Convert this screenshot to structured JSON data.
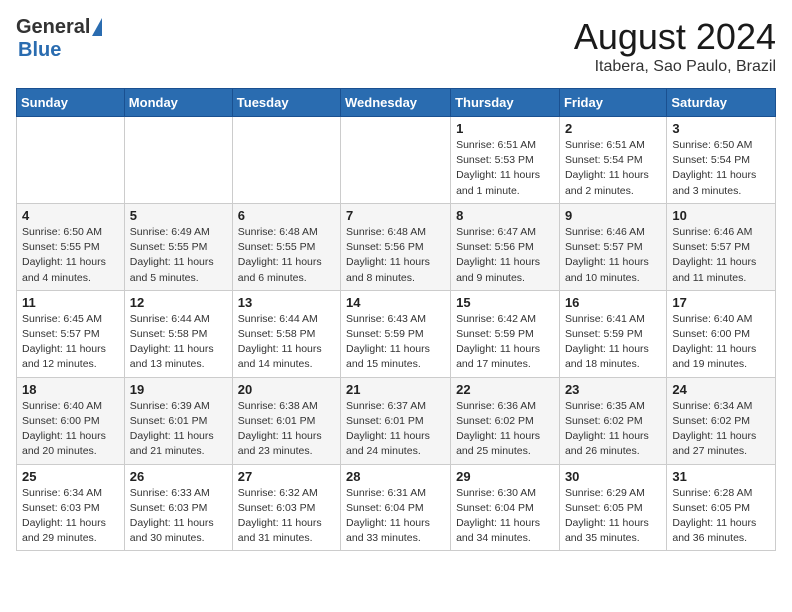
{
  "header": {
    "logo_general": "General",
    "logo_blue": "Blue",
    "title": "August 2024",
    "subtitle": "Itabera, Sao Paulo, Brazil"
  },
  "calendar": {
    "days_of_week": [
      "Sunday",
      "Monday",
      "Tuesday",
      "Wednesday",
      "Thursday",
      "Friday",
      "Saturday"
    ],
    "weeks": [
      [
        {
          "day": "",
          "info": ""
        },
        {
          "day": "",
          "info": ""
        },
        {
          "day": "",
          "info": ""
        },
        {
          "day": "",
          "info": ""
        },
        {
          "day": "1",
          "info": "Sunrise: 6:51 AM\nSunset: 5:53 PM\nDaylight: 11 hours\nand 1 minute."
        },
        {
          "day": "2",
          "info": "Sunrise: 6:51 AM\nSunset: 5:54 PM\nDaylight: 11 hours\nand 2 minutes."
        },
        {
          "day": "3",
          "info": "Sunrise: 6:50 AM\nSunset: 5:54 PM\nDaylight: 11 hours\nand 3 minutes."
        }
      ],
      [
        {
          "day": "4",
          "info": "Sunrise: 6:50 AM\nSunset: 5:55 PM\nDaylight: 11 hours\nand 4 minutes."
        },
        {
          "day": "5",
          "info": "Sunrise: 6:49 AM\nSunset: 5:55 PM\nDaylight: 11 hours\nand 5 minutes."
        },
        {
          "day": "6",
          "info": "Sunrise: 6:48 AM\nSunset: 5:55 PM\nDaylight: 11 hours\nand 6 minutes."
        },
        {
          "day": "7",
          "info": "Sunrise: 6:48 AM\nSunset: 5:56 PM\nDaylight: 11 hours\nand 8 minutes."
        },
        {
          "day": "8",
          "info": "Sunrise: 6:47 AM\nSunset: 5:56 PM\nDaylight: 11 hours\nand 9 minutes."
        },
        {
          "day": "9",
          "info": "Sunrise: 6:46 AM\nSunset: 5:57 PM\nDaylight: 11 hours\nand 10 minutes."
        },
        {
          "day": "10",
          "info": "Sunrise: 6:46 AM\nSunset: 5:57 PM\nDaylight: 11 hours\nand 11 minutes."
        }
      ],
      [
        {
          "day": "11",
          "info": "Sunrise: 6:45 AM\nSunset: 5:57 PM\nDaylight: 11 hours\nand 12 minutes."
        },
        {
          "day": "12",
          "info": "Sunrise: 6:44 AM\nSunset: 5:58 PM\nDaylight: 11 hours\nand 13 minutes."
        },
        {
          "day": "13",
          "info": "Sunrise: 6:44 AM\nSunset: 5:58 PM\nDaylight: 11 hours\nand 14 minutes."
        },
        {
          "day": "14",
          "info": "Sunrise: 6:43 AM\nSunset: 5:59 PM\nDaylight: 11 hours\nand 15 minutes."
        },
        {
          "day": "15",
          "info": "Sunrise: 6:42 AM\nSunset: 5:59 PM\nDaylight: 11 hours\nand 17 minutes."
        },
        {
          "day": "16",
          "info": "Sunrise: 6:41 AM\nSunset: 5:59 PM\nDaylight: 11 hours\nand 18 minutes."
        },
        {
          "day": "17",
          "info": "Sunrise: 6:40 AM\nSunset: 6:00 PM\nDaylight: 11 hours\nand 19 minutes."
        }
      ],
      [
        {
          "day": "18",
          "info": "Sunrise: 6:40 AM\nSunset: 6:00 PM\nDaylight: 11 hours\nand 20 minutes."
        },
        {
          "day": "19",
          "info": "Sunrise: 6:39 AM\nSunset: 6:01 PM\nDaylight: 11 hours\nand 21 minutes."
        },
        {
          "day": "20",
          "info": "Sunrise: 6:38 AM\nSunset: 6:01 PM\nDaylight: 11 hours\nand 23 minutes."
        },
        {
          "day": "21",
          "info": "Sunrise: 6:37 AM\nSunset: 6:01 PM\nDaylight: 11 hours\nand 24 minutes."
        },
        {
          "day": "22",
          "info": "Sunrise: 6:36 AM\nSunset: 6:02 PM\nDaylight: 11 hours\nand 25 minutes."
        },
        {
          "day": "23",
          "info": "Sunrise: 6:35 AM\nSunset: 6:02 PM\nDaylight: 11 hours\nand 26 minutes."
        },
        {
          "day": "24",
          "info": "Sunrise: 6:34 AM\nSunset: 6:02 PM\nDaylight: 11 hours\nand 27 minutes."
        }
      ],
      [
        {
          "day": "25",
          "info": "Sunrise: 6:34 AM\nSunset: 6:03 PM\nDaylight: 11 hours\nand 29 minutes."
        },
        {
          "day": "26",
          "info": "Sunrise: 6:33 AM\nSunset: 6:03 PM\nDaylight: 11 hours\nand 30 minutes."
        },
        {
          "day": "27",
          "info": "Sunrise: 6:32 AM\nSunset: 6:03 PM\nDaylight: 11 hours\nand 31 minutes."
        },
        {
          "day": "28",
          "info": "Sunrise: 6:31 AM\nSunset: 6:04 PM\nDaylight: 11 hours\nand 33 minutes."
        },
        {
          "day": "29",
          "info": "Sunrise: 6:30 AM\nSunset: 6:04 PM\nDaylight: 11 hours\nand 34 minutes."
        },
        {
          "day": "30",
          "info": "Sunrise: 6:29 AM\nSunset: 6:05 PM\nDaylight: 11 hours\nand 35 minutes."
        },
        {
          "day": "31",
          "info": "Sunrise: 6:28 AM\nSunset: 6:05 PM\nDaylight: 11 hours\nand 36 minutes."
        }
      ]
    ]
  }
}
